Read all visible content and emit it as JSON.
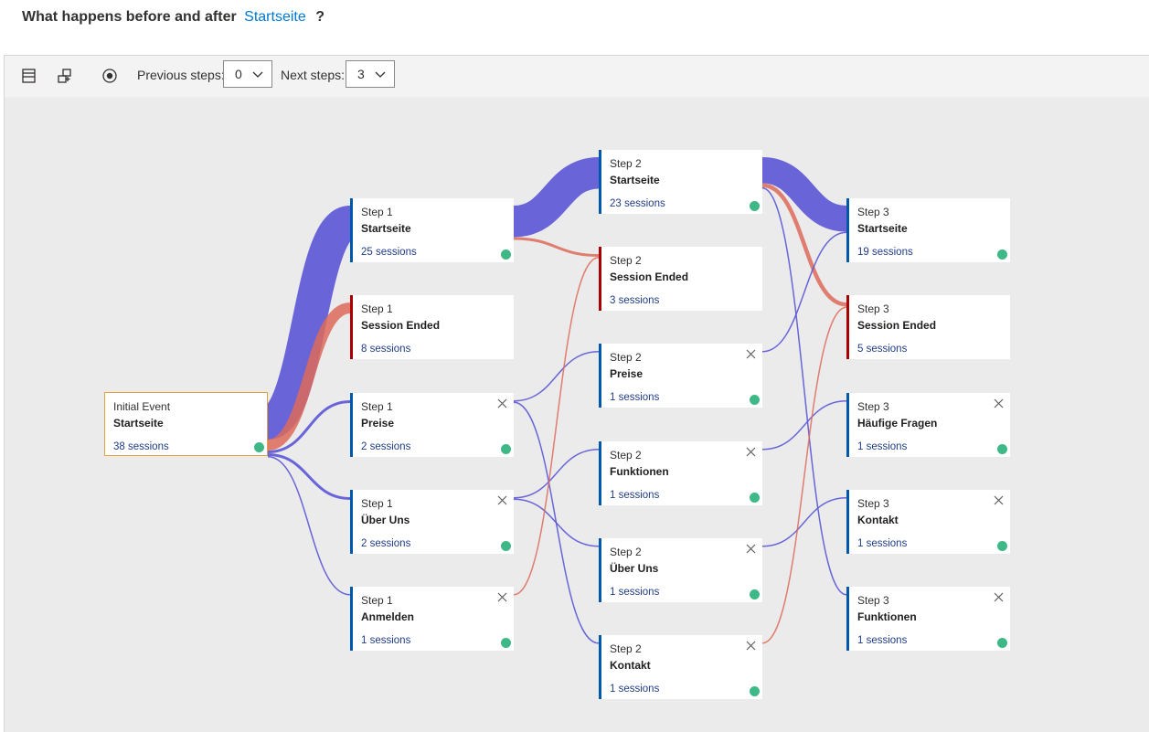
{
  "header": {
    "question_prefix": "What happens before and after",
    "event_name": "Startseite",
    "question_suffix": "?"
  },
  "toolbar": {
    "previous_steps_label": "Previous steps:",
    "previous_steps_value": "0",
    "next_steps_label": "Next steps:",
    "next_steps_value": "3",
    "icons": [
      "collapse-icon",
      "expand-nodes-icon",
      "focus-target-icon",
      "chevron-down-icon"
    ]
  },
  "colors": {
    "flow_continue": "#5b57d6",
    "flow_exit": "#dd6a5a",
    "node_bar": "#0058a8",
    "node_bar_ended": "#a80000",
    "status_dot": "#3fb887",
    "link": "#0078d4"
  },
  "nodes": [
    {
      "id": "init",
      "step": "Initial Event",
      "name": "Startseite",
      "sessions": "38 sessions",
      "type": "initial",
      "closable": false
    },
    {
      "id": "s1a",
      "step": "Step 1",
      "name": "Startseite",
      "sessions": "25 sessions",
      "type": "normal",
      "closable": false
    },
    {
      "id": "s1b",
      "step": "Step 1",
      "name": "Session Ended",
      "sessions": "8 sessions",
      "type": "ended",
      "closable": false
    },
    {
      "id": "s1c",
      "step": "Step 1",
      "name": "Preise",
      "sessions": "2 sessions",
      "type": "normal",
      "closable": true
    },
    {
      "id": "s1d",
      "step": "Step 1",
      "name": "Über Uns",
      "sessions": "2 sessions",
      "type": "normal",
      "closable": true
    },
    {
      "id": "s1e",
      "step": "Step 1",
      "name": "Anmelden",
      "sessions": "1 sessions",
      "type": "normal",
      "closable": true
    },
    {
      "id": "s2a",
      "step": "Step 2",
      "name": "Startseite",
      "sessions": "23 sessions",
      "type": "normal",
      "closable": false
    },
    {
      "id": "s2b",
      "step": "Step 2",
      "name": "Session Ended",
      "sessions": "3 sessions",
      "type": "ended",
      "closable": false
    },
    {
      "id": "s2c",
      "step": "Step 2",
      "name": "Preise",
      "sessions": "1 sessions",
      "type": "normal",
      "closable": true
    },
    {
      "id": "s2d",
      "step": "Step 2",
      "name": "Funktionen",
      "sessions": "1 sessions",
      "type": "normal",
      "closable": true
    },
    {
      "id": "s2e",
      "step": "Step 2",
      "name": "Über Uns",
      "sessions": "1 sessions",
      "type": "normal",
      "closable": true
    },
    {
      "id": "s2f",
      "step": "Step 2",
      "name": "Kontakt",
      "sessions": "1 sessions",
      "type": "normal",
      "closable": true
    },
    {
      "id": "s3a",
      "step": "Step 3",
      "name": "Startseite",
      "sessions": "19 sessions",
      "type": "normal",
      "closable": false
    },
    {
      "id": "s3b",
      "step": "Step 3",
      "name": "Session Ended",
      "sessions": "5 sessions",
      "type": "ended",
      "closable": false
    },
    {
      "id": "s3c",
      "step": "Step 3",
      "name": "Häufige Fragen",
      "sessions": "1 sessions",
      "type": "normal",
      "closable": true
    },
    {
      "id": "s3d",
      "step": "Step 3",
      "name": "Kontakt",
      "sessions": "1 sessions",
      "type": "normal",
      "closable": true
    },
    {
      "id": "s3e",
      "step": "Step 3",
      "name": "Funktionen",
      "sessions": "1 sessions",
      "type": "normal",
      "closable": true
    }
  ],
  "links": [
    {
      "from": "init",
      "to": "s1a",
      "sessions": 25
    },
    {
      "from": "init",
      "to": "s1b",
      "sessions": 8
    },
    {
      "from": "init",
      "to": "s1c",
      "sessions": 2
    },
    {
      "from": "init",
      "to": "s1d",
      "sessions": 2
    },
    {
      "from": "init",
      "to": "s1e",
      "sessions": 1
    },
    {
      "from": "s1a",
      "to": "s2a",
      "sessions": 23
    },
    {
      "from": "s1a",
      "to": "s2b",
      "sessions": 2
    },
    {
      "from": "s1c",
      "to": "s2c",
      "sessions": 1
    },
    {
      "from": "s1c",
      "to": "s2f",
      "sessions": 1
    },
    {
      "from": "s1d",
      "to": "s2d",
      "sessions": 1
    },
    {
      "from": "s1d",
      "to": "s2e",
      "sessions": 1
    },
    {
      "from": "s1e",
      "to": "s2b",
      "sessions": 1
    },
    {
      "from": "s2a",
      "to": "s3a",
      "sessions": 19
    },
    {
      "from": "s2a",
      "to": "s3b",
      "sessions": 3
    },
    {
      "from": "s2a",
      "to": "s3e",
      "sessions": 1
    },
    {
      "from": "s2c",
      "to": "s3a",
      "sessions": 1
    },
    {
      "from": "s2d",
      "to": "s3c",
      "sessions": 1
    },
    {
      "from": "s2e",
      "to": "s3d",
      "sessions": 1
    },
    {
      "from": "s2f",
      "to": "s3b",
      "sessions": 1
    }
  ]
}
